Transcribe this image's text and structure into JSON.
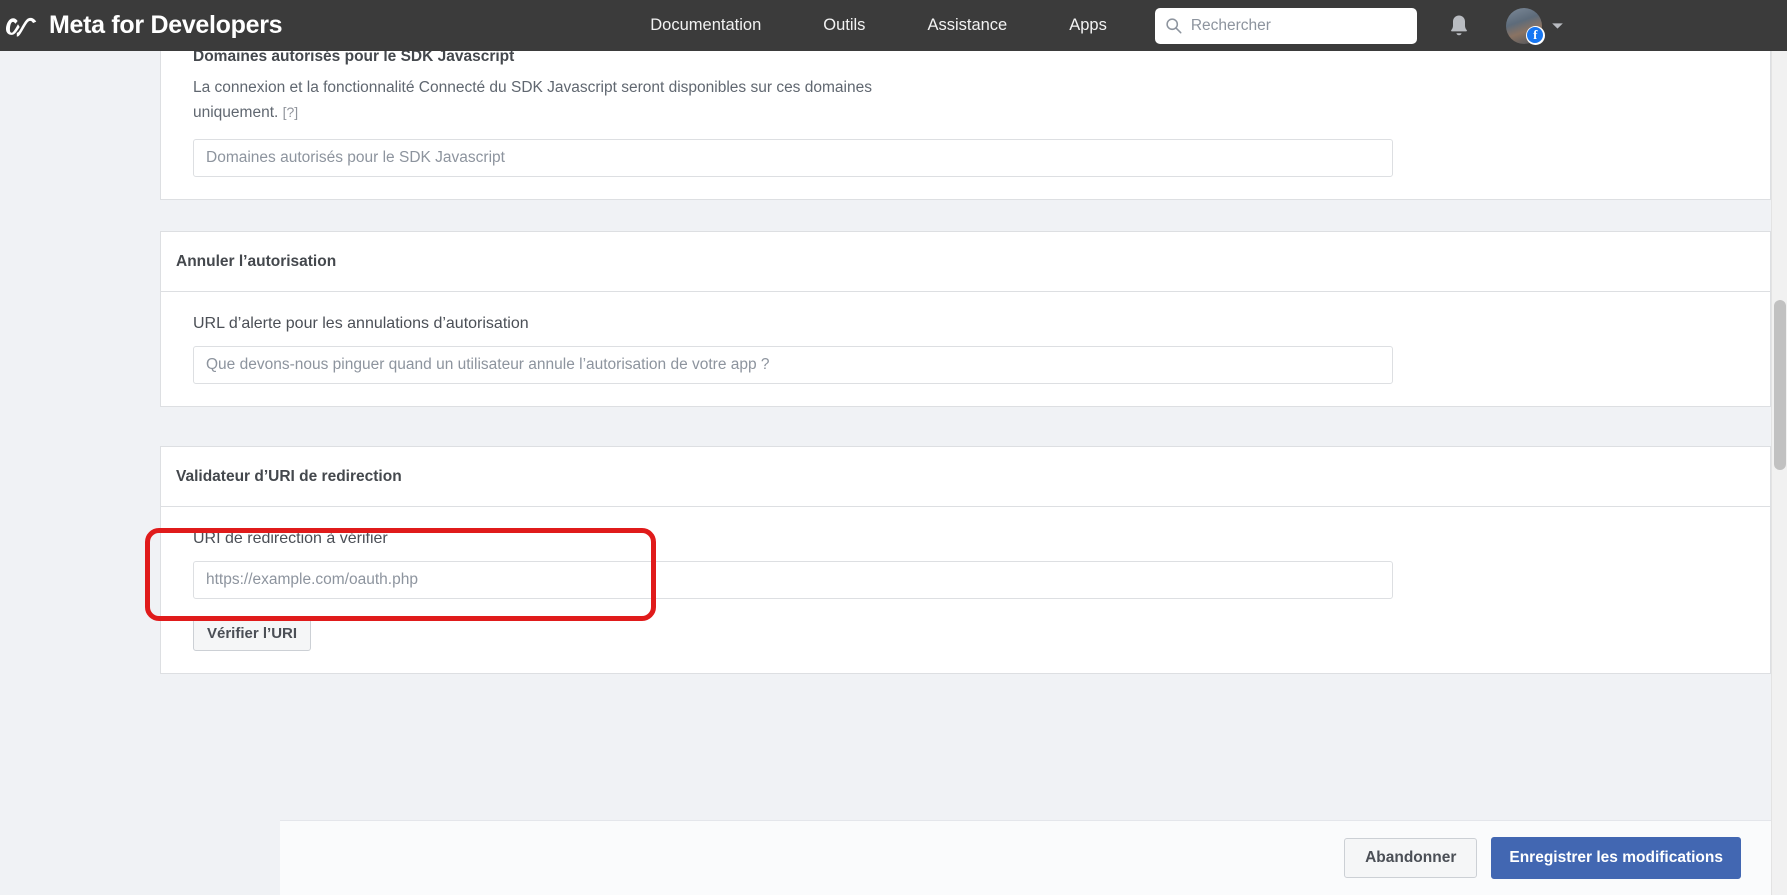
{
  "topbar": {
    "brand": "Meta for Developers",
    "logo_icon": "meta-infinity-logo",
    "nav": [
      {
        "label": "Documentation"
      },
      {
        "label": "Outils"
      },
      {
        "label": "Assistance"
      },
      {
        "label": "Apps"
      }
    ],
    "search": {
      "placeholder": "Rechercher",
      "value": "",
      "icon": "search-icon"
    },
    "notifications_icon": "bell-icon",
    "account_icon": "user-avatar",
    "account_badge": "facebook-badge",
    "caret_icon": "chevron-down-icon"
  },
  "jssdk_card": {
    "title": "Domaines autorisés pour le SDK Javascript",
    "description": "La connexion et la fonctionnalité Connecté du SDK Javascript seront disponibles sur ces domaines uniquement.",
    "help_marker": "[?]",
    "input_placeholder": "Domaines autorisés pour le SDK Javascript",
    "input_value": ""
  },
  "deauth_card": {
    "title": "Annuler l’autorisation",
    "field_label": "URL d’alerte pour les annulations d’autorisation",
    "input_placeholder": "Que devons-nous pinguer quand un utilisateur annule l’autorisation de votre app ?",
    "input_value": ""
  },
  "validator_card": {
    "title": "Validateur d’URI de redirection",
    "field_label": "URI de redirection à vérifier",
    "input_placeholder": "https://example.com/oauth.php",
    "input_value": "",
    "verify_button": "Vérifier l’URI"
  },
  "footer": {
    "cancel_label": "Abandonner",
    "save_label": "Enregistrer les modifications"
  },
  "annotation": {
    "type": "red-highlight-rectangle",
    "color": "#e01b1b",
    "targets": "uri-redirect-field-group"
  },
  "colors": {
    "topbar_bg": "#3b3b3b",
    "page_bg": "#f0f2f5",
    "card_bg": "#ffffff",
    "card_border": "#dddfe2",
    "primary_button": "#4267b2",
    "annotation_red": "#e01b1b",
    "facebook_blue": "#1877f2"
  }
}
